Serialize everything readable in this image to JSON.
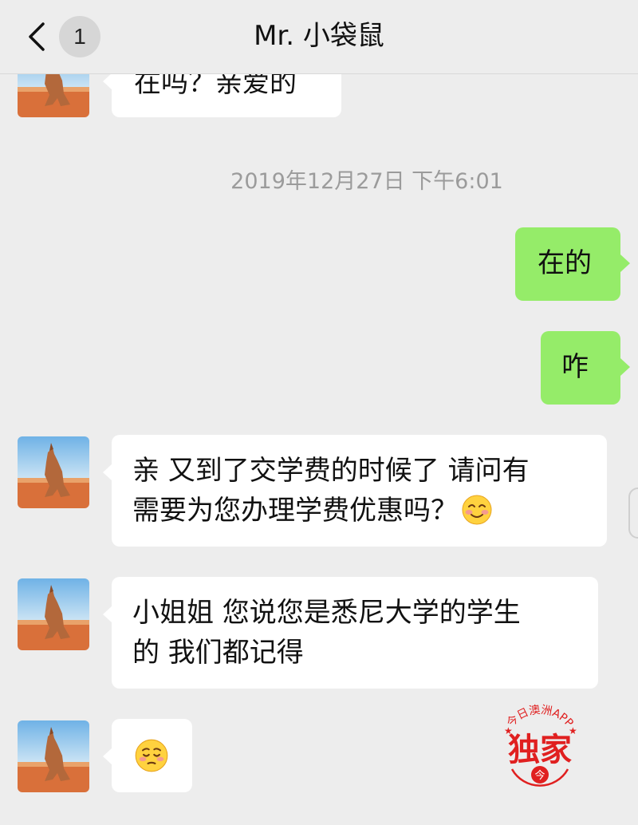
{
  "header": {
    "back_badge": "1",
    "title": "Mr. 小袋鼠"
  },
  "messages": [
    {
      "sender": "contact",
      "text": "在吗？亲爱的"
    },
    {
      "sender": "me",
      "text": "在的"
    },
    {
      "sender": "me",
      "text": "咋"
    },
    {
      "sender": "contact",
      "text": "亲 又到了交学费的时候了 请问有需要为您办理学费优惠吗？",
      "line1": "亲 又到了交学费的时候了 请问有",
      "line2": "需要为您办理学费优惠吗？",
      "emoji": "smiling-blush-emoji"
    },
    {
      "sender": "contact",
      "line1": "小姐姐 您说您是悉尼大学的学生",
      "line2": "的 我们都记得"
    },
    {
      "sender": "contact",
      "emoji": "pleading-emoji"
    }
  ],
  "timestamp": "2019年12月27日 下午6:01",
  "watermark": {
    "arc_text": "今日澳洲APP",
    "main_text": "独家",
    "badge": "今",
    "color": "#e02020"
  },
  "colors": {
    "background": "#ededed",
    "my_bubble": "#95ec69",
    "their_bubble": "#ffffff"
  }
}
